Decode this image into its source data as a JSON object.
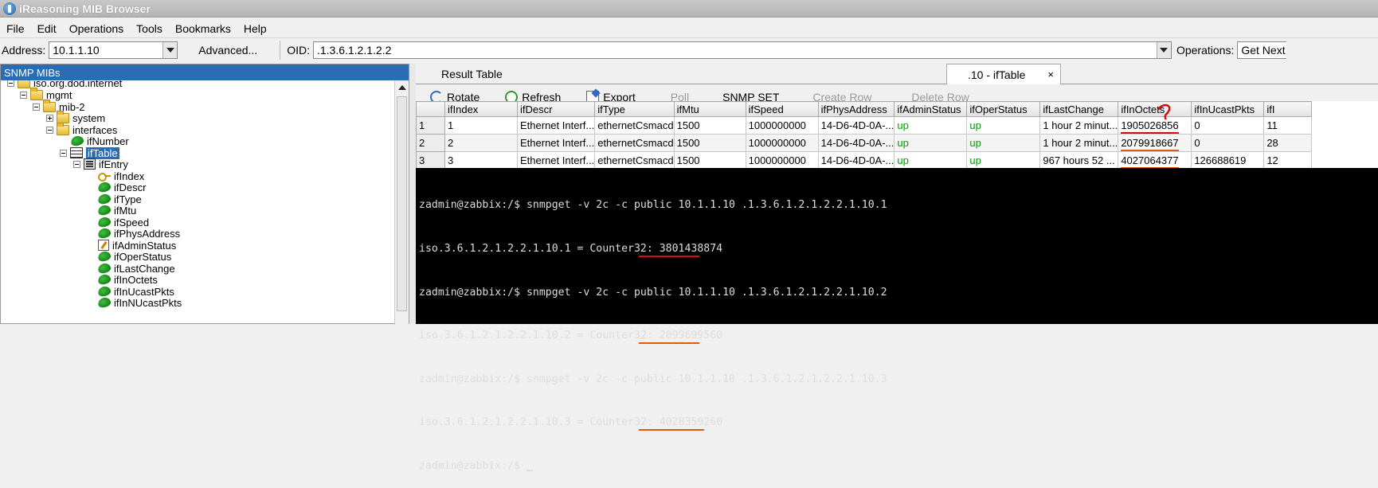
{
  "window": {
    "title": "iReasoning MIB Browser"
  },
  "menu": [
    "File",
    "Edit",
    "Operations",
    "Tools",
    "Bookmarks",
    "Help"
  ],
  "toolbar": {
    "address_label": "Address:",
    "address_value": "10.1.1.10",
    "advanced_label": "Advanced...",
    "oid_label": "OID:",
    "oid_value": ".1.3.6.1.2.1.2.2",
    "operations_label": "Operations:",
    "operations_value": "Get Next"
  },
  "mib_panel": {
    "header": "SNMP MIBs",
    "nodes": [
      {
        "label": "iso.org.dod.internet",
        "icon": "folder-icon",
        "expander": "minus"
      },
      {
        "label": "mgmt",
        "icon": "folder-icon",
        "expander": "minus"
      },
      {
        "label": "mib-2",
        "icon": "folder-icon",
        "expander": "minus"
      },
      {
        "label": "system",
        "icon": "folder-icon",
        "expander": "plus"
      },
      {
        "label": "interfaces",
        "icon": "folder-icon",
        "expander": "minus"
      },
      {
        "label": "ifNumber",
        "icon": "leaf-icon",
        "expander": "none"
      },
      {
        "label": "ifTable",
        "icon": "table-icon",
        "expander": "minus",
        "selected": true
      },
      {
        "label": "ifEntry",
        "icon": "entry-icon",
        "expander": "minus"
      },
      {
        "label": "ifIndex",
        "icon": "key-icon",
        "expander": "none"
      },
      {
        "label": "ifDescr",
        "icon": "leaf-icon",
        "expander": "none"
      },
      {
        "label": "ifType",
        "icon": "leaf-icon",
        "expander": "none"
      },
      {
        "label": "ifMtu",
        "icon": "leaf-icon",
        "expander": "none"
      },
      {
        "label": "ifSpeed",
        "icon": "leaf-icon",
        "expander": "none"
      },
      {
        "label": "ifPhysAddress",
        "icon": "leaf-icon",
        "expander": "none"
      },
      {
        "label": "ifAdminStatus",
        "icon": "edit-icon",
        "expander": "none"
      },
      {
        "label": "ifOperStatus",
        "icon": "leaf-icon",
        "expander": "none"
      },
      {
        "label": "ifLastChange",
        "icon": "leaf-icon",
        "expander": "none"
      },
      {
        "label": "ifInOctets",
        "icon": "leaf-icon",
        "expander": "none"
      },
      {
        "label": "ifInUcastPkts",
        "icon": "leaf-icon",
        "expander": "none"
      },
      {
        "label": "ifInNUcastPkts",
        "icon": "leaf-icon",
        "expander": "none"
      }
    ]
  },
  "tabs": {
    "result": "Result Table",
    "iftable": ".10 - ifTable",
    "close": "×"
  },
  "result_toolbar": {
    "rotate": "Rotate",
    "refresh": "Refresh",
    "export": "Export",
    "poll": "Poll",
    "snmp_set": "SNMP SET",
    "create_row": "Create Row",
    "delete_row": "Delete Row"
  },
  "table": {
    "columns": [
      "ifIndex",
      "ifDescr",
      "ifType",
      "ifMtu",
      "ifSpeed",
      "ifPhysAddress",
      "ifAdminStatus",
      "ifOperStatus",
      "ifLastChange",
      "ifInOctets",
      "ifInUcastPkts",
      "ifI"
    ],
    "rows": [
      {
        "n": "1",
        "cells": [
          "1",
          "Ethernet Interf...",
          "ethernetCsmacd",
          "1500",
          "1000000000",
          "14-D6-4D-0A-...",
          "up",
          "up",
          "1 hour 2 minut...",
          "1905026856",
          "0",
          "11"
        ]
      },
      {
        "n": "2",
        "cells": [
          "2",
          "Ethernet Interf...",
          "ethernetCsmacd",
          "1500",
          "1000000000",
          "14-D6-4D-0A-...",
          "up",
          "up",
          "1 hour 2 minut...",
          "2079918667",
          "0",
          "28"
        ]
      },
      {
        "n": "3",
        "cells": [
          "3",
          "Ethernet Interf...",
          "ethernetCsmacd",
          "1500",
          "1000000000",
          "14-D6-4D-0A-...",
          "up",
          "up",
          "967 hours 52 ...",
          "4027064377",
          "126688619",
          "12"
        ]
      }
    ]
  },
  "terminal": {
    "lines": [
      "zadmin@zabbix:/$ snmpget -v 2c -c public 10.1.1.10 .1.3.6.1.2.1.2.2.1.10.1",
      "iso.3.6.1.2.1.2.2.1.10.1 = Counter32: 3801438874",
      "zadmin@zabbix:/$ snmpget -v 2c -c public 10.1.1.10 .1.3.6.1.2.1.2.2.1.10.2",
      "iso.3.6.1.2.1.2.2.1.10.2 = Counter32: 2099699560",
      "zadmin@zabbix:/$ snmpget -v 2c -c public 10.1.1.10 .1.3.6.1.2.1.2.2.1.10.3",
      "iso.3.6.1.2.1.2.2.1.10.3 = Counter32: 4028359260",
      "zadmin@zabbix:/$ "
    ]
  },
  "colors": {
    "accent": "#2a6db3",
    "status_up": "#00a000",
    "annotation_orange": "#e05a10",
    "annotation_red": "#d01010"
  }
}
